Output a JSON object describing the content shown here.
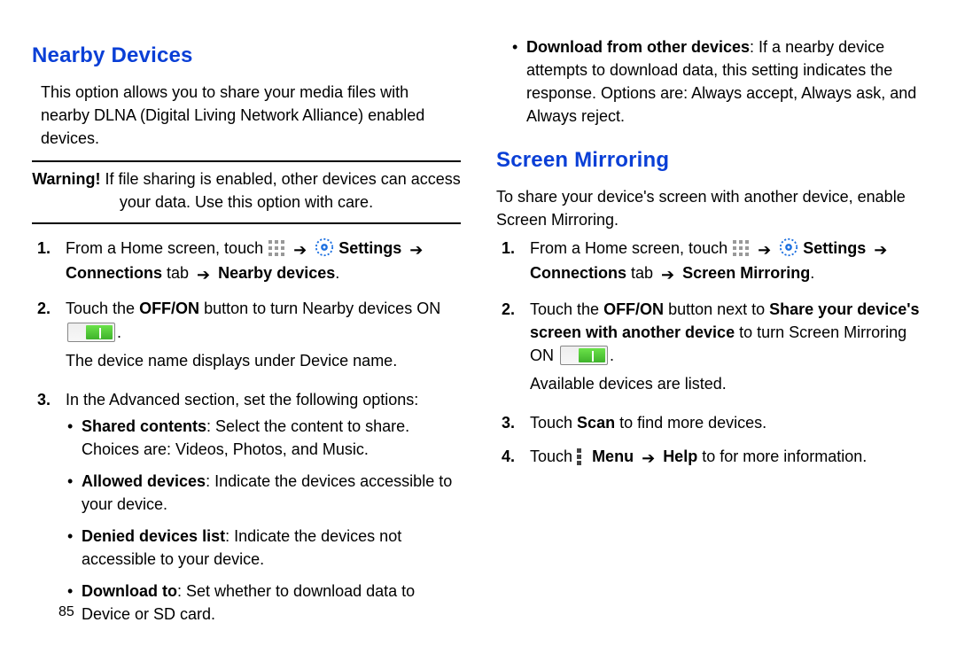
{
  "pageNumber": "85",
  "arrow": "➔",
  "left": {
    "heading": "Nearby Devices",
    "intro": "This option allows you to share your media files with nearby DLNA (Digital Living Network Alliance) enabled devices.",
    "warning_bold": "Warning!",
    "warning_text1": " If file sharing is enabled, other devices can access",
    "warning_text2": "your data. Use this option with care.",
    "steps": {
      "s1_num": "1.",
      "s1_a": "From a Home screen, touch ",
      "s1_settings": "Settings",
      "s1_conn": "Connections",
      "s1_tab": " tab ",
      "s1_nearby": "Nearby devices",
      "s2_num": "2.",
      "s2_a": "Touch the ",
      "s2_offon": "OFF/ON",
      "s2_b": " button to turn Nearby devices ON ",
      "s2_c": ".",
      "s2_d": "The device name displays under Device name.",
      "s3_num": "3.",
      "s3_a": "In the Advanced section, set the following options:",
      "b1_t": "Shared contents",
      "b1_d": ": Select the content to share. Choices are: Videos, Photos, and Music.",
      "b2_t": "Allowed devices",
      "b2_d": ": Indicate the devices accessible to your device.",
      "b3_t": "Denied devices list",
      "b3_d": ": Indicate the devices not accessible to your device.",
      "b4_t": "Download to",
      "b4_d": ": Set whether to download data to Device or SD card."
    }
  },
  "right": {
    "b5_t": "Download from other devices",
    "b5_d": ": If a nearby device attempts to download data, this setting indicates the response. Options are: Always accept, Always ask, and Always reject.",
    "heading": "Screen Mirroring",
    "intro": "To share your device's screen with another device, enable Screen Mirroring.",
    "steps": {
      "s1_num": "1.",
      "s1_a": "From a Home screen, touch ",
      "s1_settings": "Settings",
      "s1_conn": "Connections",
      "s1_tab": " tab ",
      "s1_sm": "Screen Mirroring",
      "s2_num": "2.",
      "s2_a": "Touch the ",
      "s2_offon": "OFF/ON",
      "s2_b": " button next to ",
      "s2_share": "Share your device's screen with another device",
      "s2_c": " to turn Screen Mirroring ON ",
      "s2_d": ".",
      "s2_e": "Available devices are listed.",
      "s3_num": "3.",
      "s3_a": "Touch ",
      "s3_scan": "Scan",
      "s3_b": " to find more devices.",
      "s4_num": "4.",
      "s4_a": "Touch ",
      "s4_menu": "Menu",
      "s4_help": "Help",
      "s4_b": " to for more information."
    }
  }
}
